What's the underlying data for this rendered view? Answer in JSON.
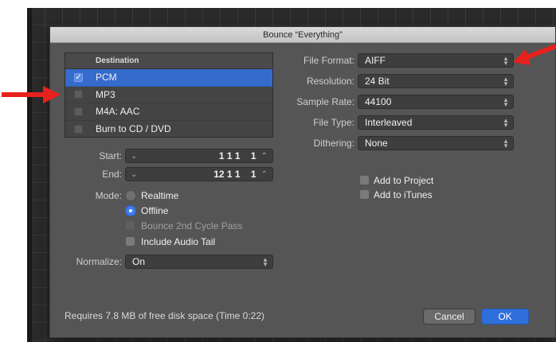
{
  "dialog": {
    "title": "Bounce “Everything”"
  },
  "destination": {
    "header": "Destination",
    "items": [
      {
        "label": "PCM",
        "checked": true,
        "selected": true
      },
      {
        "label": "MP3",
        "checked": false,
        "selected": false
      },
      {
        "label": "M4A: AAC",
        "checked": false,
        "selected": false
      },
      {
        "label": "Burn to CD / DVD",
        "checked": false,
        "selected": false
      }
    ]
  },
  "start": {
    "label": "Start:",
    "value": "1 1 1",
    "sub": "1"
  },
  "end": {
    "label": "End:",
    "value": "12 1 1",
    "sub": "1"
  },
  "mode": {
    "label": "Mode:",
    "realtime": "Realtime",
    "offline": "Offline",
    "selected": "Offline",
    "bounce_2nd_cycle": "Bounce 2nd Cycle Pass",
    "include_audio_tail": "Include Audio Tail"
  },
  "normalize": {
    "label": "Normalize:",
    "value": "On"
  },
  "format": {
    "file_format": {
      "label": "File Format:",
      "value": "AIFF"
    },
    "resolution": {
      "label": "Resolution:",
      "value": "24 Bit"
    },
    "sample_rate": {
      "label": "Sample Rate:",
      "value": "44100"
    },
    "file_type": {
      "label": "File Type:",
      "value": "Interleaved"
    },
    "dithering": {
      "label": "Dithering:",
      "value": "None"
    }
  },
  "options": {
    "add_to_project": "Add to Project",
    "add_to_itunes": "Add to iTunes"
  },
  "status": "Requires 7.8 MB of free disk space  (Time 0:22)",
  "buttons": {
    "cancel": "Cancel",
    "ok": "OK"
  },
  "icons": {
    "check": "✓",
    "chevron_down": "⌄",
    "chevron_up": "⌃",
    "select_arrows": "▴▾"
  },
  "colors": {
    "accent": "#2f6fdc",
    "annotation": "#e8211c",
    "selection": "#356bcc"
  }
}
